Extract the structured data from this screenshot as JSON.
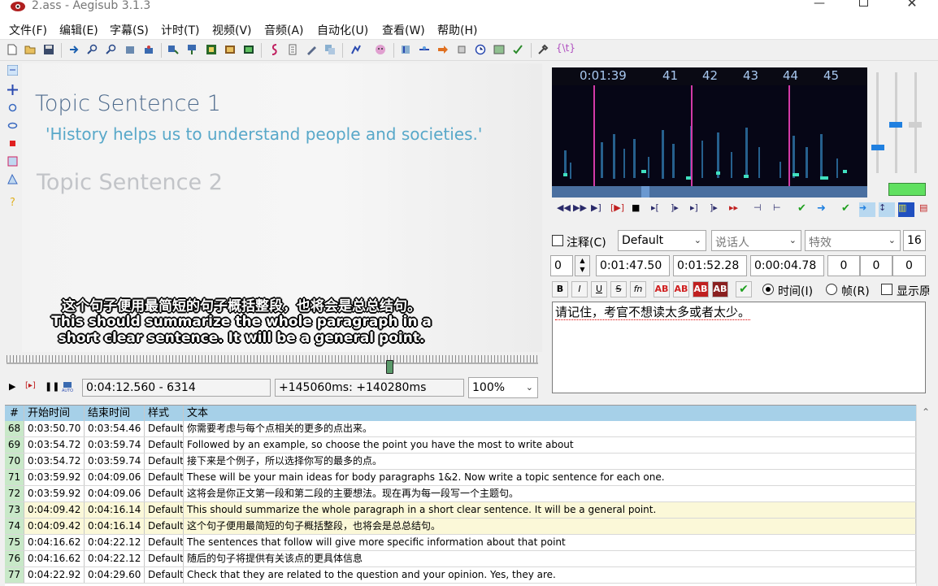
{
  "window": {
    "title": "2.ass - Aegisub 3.1.3",
    "minimize": "—",
    "close": "✕"
  },
  "menu": [
    "文件(F)",
    "编辑(E)",
    "字幕(S)",
    "计时(T)",
    "视频(V)",
    "音频(A)",
    "自动化(U)",
    "查看(W)",
    "帮助(H)"
  ],
  "video": {
    "slide_title1": "Topic Sentence 1",
    "slide_quote": "'History helps us to understand people and societies.'",
    "slide_title2": "Topic Sentence 2",
    "subtitle_zh": "这个句子便用最简短的句子概括整段，也将会是总总结句。",
    "subtitle_en1": "This should summarize the whole paragraph in a",
    "subtitle_en2": "short clear sentence. It will be a general point.",
    "seek_position": 0.72,
    "time_display": "0:04:12.560 - 6314",
    "offset_display": "+145060ms: +140280ms",
    "zoom": "100%"
  },
  "audio": {
    "ruler_time": "0:01:39",
    "ruler_labels": [
      "41",
      "42",
      "43",
      "44",
      "45"
    ]
  },
  "edit": {
    "comment_label": "注释(C)",
    "style": "Default",
    "actor": "说话人",
    "effect": "特效",
    "layer_count": "16",
    "layer": "0",
    "start_time": "0:01:47.50",
    "end_time": "0:01:52.28",
    "duration": "0:00:04.78",
    "margin_l": "0",
    "margin_r": "0",
    "margin_v": "0",
    "fmt_buttons": [
      "B",
      "I",
      "U",
      "S",
      "fn",
      "AB",
      "AB",
      "AB",
      "AB"
    ],
    "radio_time": "时间(I)",
    "radio_frame": "帧(R)",
    "show_original": "显示原",
    "text": "请记住，考官不想读太多或者太少。"
  },
  "grid": {
    "headers": {
      "num": "#",
      "start": "开始时间",
      "end": "结束时间",
      "style": "样式",
      "text": "文本"
    },
    "rows": [
      {
        "num": "68",
        "start": "0:03:50.70",
        "end": "0:03:54.46",
        "style": "Default",
        "text": "你需要考虑与每个点相关的更多的点出来。"
      },
      {
        "num": "69",
        "start": "0:03:54.72",
        "end": "0:03:59.74",
        "style": "Default",
        "text": "Followed by an example, so choose the point you have the most to write about"
      },
      {
        "num": "70",
        "start": "0:03:54.72",
        "end": "0:03:59.74",
        "style": "Default",
        "text": "接下来是个例子，所以选择你写的最多的点。"
      },
      {
        "num": "71",
        "start": "0:03:59.92",
        "end": "0:04:09.06",
        "style": "Default",
        "text": "These will be your main ideas for body paragraphs 1&2. Now write a topic sentence for each one."
      },
      {
        "num": "72",
        "start": "0:03:59.92",
        "end": "0:04:09.06",
        "style": "Default",
        "text": "这将会是你正文第一段和第二段的主要想法。现在再为每一段写一个主题句。"
      },
      {
        "num": "73",
        "start": "0:04:09.42",
        "end": "0:04:16.14",
        "style": "Default",
        "text": "This should summarize the whole paragraph in a short clear sentence. It will be a general point."
      },
      {
        "num": "74",
        "start": "0:04:09.42",
        "end": "0:04:16.14",
        "style": "Default",
        "text": "这个句子便用最简短的句子概括整段，也将会是总总结句。"
      },
      {
        "num": "75",
        "start": "0:04:16.62",
        "end": "0:04:22.12",
        "style": "Default",
        "text": "The sentences that follow will give more specific information about that point"
      },
      {
        "num": "76",
        "start": "0:04:16.62",
        "end": "0:04:22.12",
        "style": "Default",
        "text": "随后的句子将提供有关该点的更具体信息"
      },
      {
        "num": "77",
        "start": "0:04:22.92",
        "end": "0:04:29.60",
        "style": "Default",
        "text": "Check that they are related to the question and your opinion. Yes, they are."
      }
    ]
  },
  "colors": {
    "grid_header": "#a6d0e8",
    "grid_num": "#c8e8c8",
    "highlight_row": "#fbf8d8",
    "audio_marker": "#d23aa7"
  },
  "icons": [
    "app-icon",
    "new-file-icon",
    "open-icon",
    "save-icon",
    "jump-icon",
    "zoom-icon",
    "play-icon",
    "pause-icon",
    "stop-icon",
    "commit-icon"
  ]
}
